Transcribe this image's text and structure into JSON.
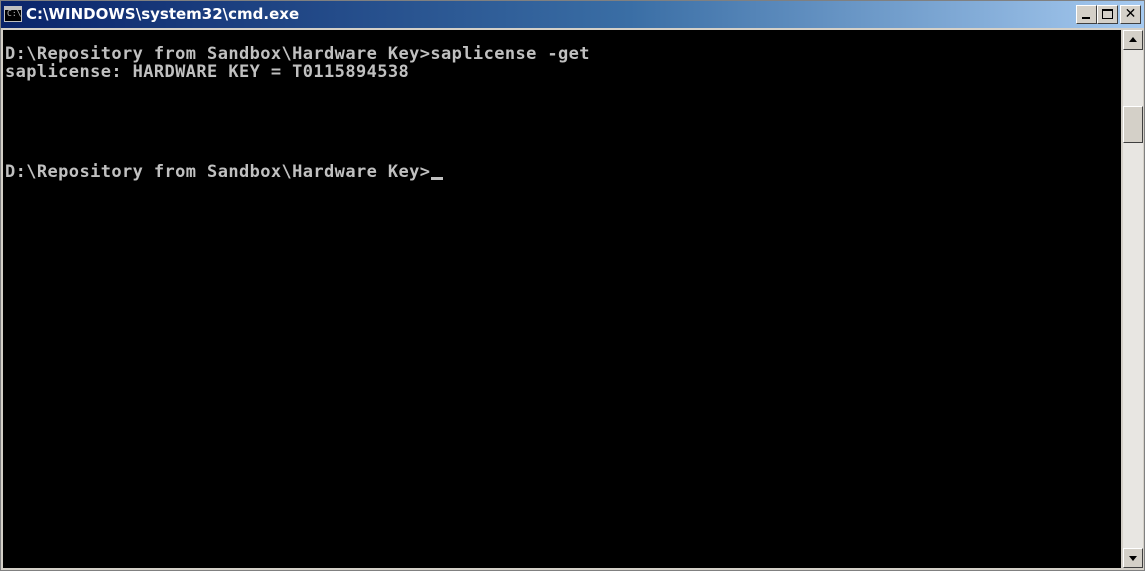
{
  "window": {
    "title": "C:\\WINDOWS\\system32\\cmd.exe",
    "icon": "cmd-prompt-icon",
    "icon_text": "C:\\",
    "close_glyph": "✕"
  },
  "console": {
    "lines": [
      "D:\\Repository from Sandbox\\Hardware Key>saplicense -get",
      "saplicense: HARDWARE KEY = T0115894538",
      "",
      "D:\\Repository from Sandbox\\Hardware Key>"
    ],
    "text_color": "#c0c0c0",
    "background_color": "#000000"
  },
  "colors": {
    "titlebar_start": "#0a246a",
    "titlebar_end": "#a6caf0",
    "chrome": "#d4d0c8"
  }
}
